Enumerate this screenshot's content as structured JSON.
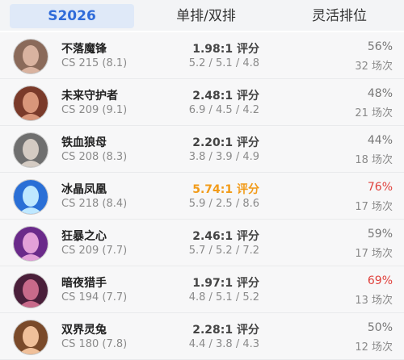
{
  "tabs": [
    "S2026",
    "单排/双排",
    "灵活排位"
  ],
  "colors": {
    "accent": "#2f6bd9",
    "highlight": "#f29b19",
    "red": "#e0413c"
  },
  "rows": [
    {
      "name": "不落魔锋",
      "cs": "CS 215 (8.1)",
      "rating": "1.98:1 评分",
      "kda": "5.2 / 5.1 / 4.8",
      "winrate": "56%",
      "games": "32 场次",
      "avatar_icon": "champion-portrait-icon",
      "avatar_bg": "#8a6a5a",
      "avatar_fg": "#d9b3a0"
    },
    {
      "name": "未来守护者",
      "cs": "CS 209 (9.1)",
      "rating": "2.48:1 评分",
      "kda": "6.9 / 4.5 / 4.2",
      "winrate": "48%",
      "games": "21 场次",
      "avatar_icon": "champion-portrait-icon",
      "avatar_bg": "#7a3a2a",
      "avatar_fg": "#d9967a"
    },
    {
      "name": "铁血狼母",
      "cs": "CS 208 (8.3)",
      "rating": "2.20:1 评分",
      "kda": "3.8 / 3.9 / 4.9",
      "winrate": "44%",
      "games": "18 场次",
      "avatar_icon": "champion-portrait-icon",
      "avatar_bg": "#6f6f6f",
      "avatar_fg": "#d4cbc3"
    },
    {
      "name": "冰晶凤凰",
      "cs": "CS 218 (8.4)",
      "rating": "5.74:1 评分",
      "kda": "5.9 / 2.5 / 8.6",
      "winrate": "76%",
      "games": "17 场次",
      "avatar_icon": "champion-portrait-icon",
      "avatar_bg": "#2a6fd6",
      "avatar_fg": "#bfe8ff",
      "highlight": true,
      "wr_red": true
    },
    {
      "name": "狂暴之心",
      "cs": "CS 209 (7.7)",
      "rating": "2.46:1 评分",
      "kda": "5.7 / 5.2 / 7.2",
      "winrate": "59%",
      "games": "17 场次",
      "avatar_icon": "champion-portrait-icon",
      "avatar_bg": "#6a2a8a",
      "avatar_fg": "#e3a0d8"
    },
    {
      "name": "暗夜猎手",
      "cs": "CS 194 (7.7)",
      "rating": "1.97:1 评分",
      "kda": "4.8 / 5.1 / 5.2",
      "winrate": "69%",
      "games": "13 场次",
      "avatar_icon": "champion-portrait-icon",
      "avatar_bg": "#4a1f3a",
      "avatar_fg": "#c86a8a",
      "wr_red": true
    },
    {
      "name": "双界灵兔",
      "cs": "CS 180 (7.8)",
      "rating": "2.28:1 评分",
      "kda": "4.4 / 3.8 / 4.3",
      "winrate": "50%",
      "games": "12 场次",
      "avatar_icon": "champion-portrait-icon",
      "avatar_bg": "#7a4a2a",
      "avatar_fg": "#f0c09a"
    }
  ]
}
